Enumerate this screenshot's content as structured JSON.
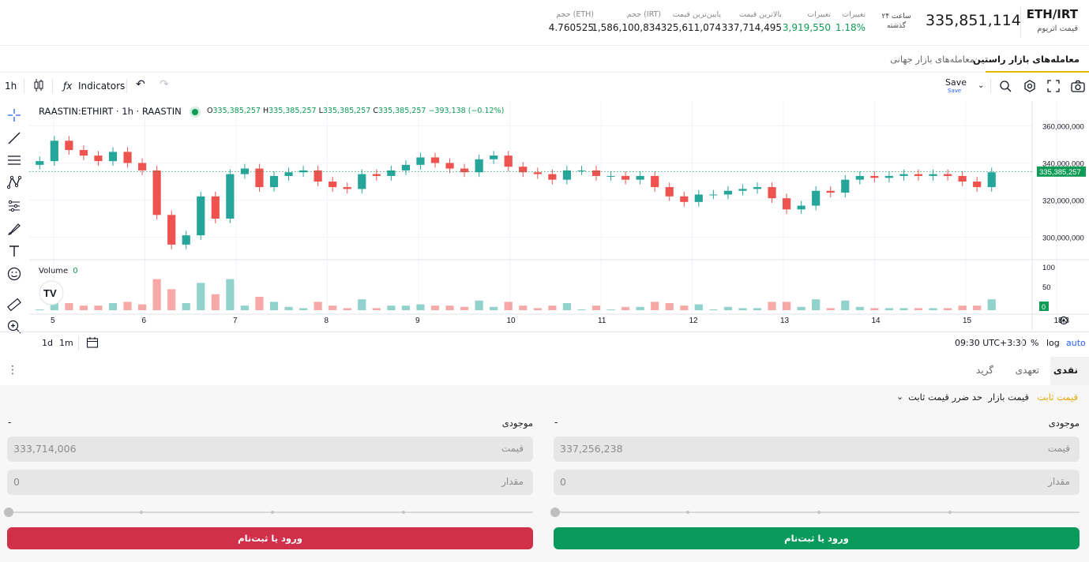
{
  "header": {
    "pair": "ETH/IRT",
    "pair_subtitle": "قیمت اتریوم",
    "last_price": "335,851,114",
    "period_top": "۲۴ ساعت",
    "period_bottom": "گذشته",
    "stats": [
      {
        "label": "تغییرات",
        "value": "1.18%",
        "positive": true
      },
      {
        "label": "تغییرات",
        "value": "3,919,550",
        "positive": true
      },
      {
        "label": "بالاترین قیمت",
        "value": "337,714,495"
      },
      {
        "label": "پایین‌ترین قیمت",
        "value": "325,611,074"
      },
      {
        "label": "حجم (IRT)",
        "value": "1,586,100,834"
      },
      {
        "label": "حجم (ETH)",
        "value": "4.760525"
      }
    ]
  },
  "tabs": {
    "active": "معامله‌های بازار راستین",
    "inactive": "معامله‌های بازار جهانی"
  },
  "toolbar": {
    "interval": "1h",
    "indicators": "Indicators",
    "save": "Save",
    "save_sub": "Save"
  },
  "legend": {
    "symbol": "RAASTIN:ETHIRT · 1h · RAASTIN",
    "o_label": "O",
    "o": "335,385,257",
    "h_label": "H",
    "h": "335,385,257",
    "l_label": "L",
    "l": "335,385,257",
    "c_label": "C",
    "c": "335,385,257",
    "change": "−393,138 (−0.12%)",
    "volume_label": "Volume",
    "volume_value": "0"
  },
  "chart_data": {
    "type": "candlestick",
    "price_axis_ticks": [
      "360,000,000",
      "340,000,000",
      "320,000,000",
      "300,000,000"
    ],
    "price_axis_values": [
      360000000,
      340000000,
      320000000,
      300000000
    ],
    "last_price_label": "335,385,257",
    "last_price_value": 335385257,
    "volume_axis_ticks": [
      "100",
      "50",
      "0"
    ],
    "time_axis_ticks": [
      "5",
      "6",
      "7",
      "8",
      "9",
      "10",
      "11",
      "12",
      "13",
      "14",
      "15",
      "18:3"
    ],
    "ylim": [
      290000000,
      370000000
    ],
    "closes": [
      341000000,
      352000000,
      347000000,
      344000000,
      341000000,
      346000000,
      340000000,
      336000000,
      312000000,
      296000000,
      301000000,
      322000000,
      310000000,
      334000000,
      337000000,
      327000000,
      333000000,
      335000000,
      336000000,
      330000000,
      327000000,
      326000000,
      334000000,
      333000000,
      336000000,
      339000000,
      343000000,
      340000000,
      337000000,
      335000000,
      342000000,
      344000000,
      338000000,
      335000000,
      334000000,
      331000000,
      336000000,
      336000000,
      333000000,
      333000000,
      331000000,
      333000000,
      327000000,
      322000000,
      319000000,
      323000000,
      323000000,
      325000000,
      326000000,
      327000000,
      321000000,
      315000000,
      317000000,
      325000000,
      324000000,
      331000000,
      333000000,
      332000000,
      333000000,
      334000000,
      333000000,
      334000000,
      333000000,
      330000000,
      327000000,
      335000000
    ]
  },
  "chart_bottom": {
    "range_1d": "1d",
    "range_1m": "1m",
    "time": "09:30 UTC+3:30",
    "percent": "%",
    "log": "log",
    "auto": "auto"
  },
  "order": {
    "tabs": [
      "نقدی",
      "تعهدی",
      "گرید"
    ],
    "types": [
      "قیمت ثابت",
      "قیمت بازار",
      "حد ضرر قیمت ثابت"
    ],
    "balance_label": "موجودی",
    "balance_value": "-",
    "price_label": "قیمت",
    "amount_label": "مقدار",
    "buy_price": "337,256,238",
    "sell_price": "333,714,006",
    "buy_amount": "0",
    "sell_amount": "0",
    "buy_button": "ورود یا ثبت‌نام",
    "sell_button": "ورود یا ثبت‌نام",
    "colors": {
      "buy": "#0a9a5b",
      "sell": "#d0304a",
      "accent": "#e6a800"
    }
  }
}
